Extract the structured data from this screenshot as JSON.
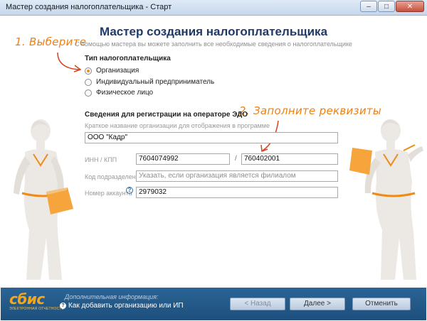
{
  "window": {
    "title": "Мастер создания налогоплательщика - Старт",
    "minimize": "–",
    "maximize": "□",
    "close": "✕"
  },
  "header": {
    "title": "Мастер создания налогоплательщика",
    "subtitle": "С помощью мастера вы можете заполнить все необходимые сведения о налогоплательщике"
  },
  "annotations": {
    "step1": "1. Выберите",
    "step2": "2. Заполните реквизиты",
    "color": "#f07f12"
  },
  "taxpayer_type": {
    "label": "Тип налогоплательщика",
    "options": [
      {
        "label": "Организация",
        "selected": true
      },
      {
        "label": "Индивидуальный предприниматель",
        "selected": false
      },
      {
        "label": "Физическое лицо",
        "selected": false
      }
    ]
  },
  "registration": {
    "label": "Сведения для регистрации на операторе ЭДО",
    "short_name_label": "Краткое название организации для отображения в программе",
    "short_name_value": "ООО \"Кадр\"",
    "inn_kpp_label": "ИНН / КПП",
    "inn_value": "7604074992",
    "kpp_separator": "/",
    "kpp_value": "760402001",
    "subdivision_label": "Код подразделения",
    "subdivision_placeholder": "Указать, если организация является филиалом",
    "account_label": "Номер аккаунта",
    "account_help": "?",
    "account_value": "2979032"
  },
  "footer": {
    "logo_text": "сбис",
    "logo_tagline": "ЭЛЕКТРОННАЯ ОТЧЕТНОСТЬ",
    "info_label": "Дополнительная информация:",
    "info_link": "Как добавить организацию или ИП",
    "back_button": "< Назад",
    "next_button": "Далее >",
    "cancel_button": "Отменить"
  },
  "colors": {
    "accent": "#f08a17",
    "title_blue": "#1e3a68",
    "footer_blue": "#1d4f7c",
    "logo_orange": "#f5a61b"
  }
}
